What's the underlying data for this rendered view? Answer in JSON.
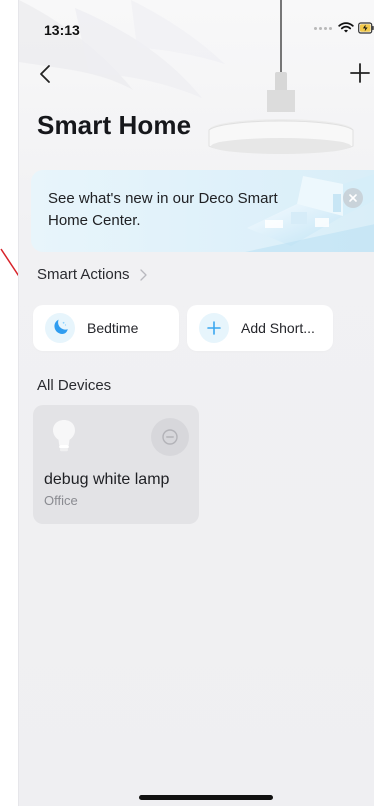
{
  "status_bar": {
    "time": "13:13",
    "icons": [
      "signal-dots-icon",
      "wifi-icon",
      "battery-charging-icon"
    ]
  },
  "navigation": {
    "back_icon": "chevron-left-icon",
    "add_icon": "plus-icon"
  },
  "header": {
    "title": "Smart Home"
  },
  "promo_banner": {
    "text": "See what's new in our Deco Smart Home Center.",
    "close_icon": "close-icon"
  },
  "smart_actions": {
    "title": "Smart Actions",
    "chevron_icon": "chevron-right-icon",
    "items": [
      {
        "label": "Bedtime",
        "icon": "moon-icon",
        "accent": "#2f9df0"
      },
      {
        "label": "Add Short...",
        "icon": "plus-icon",
        "accent": "#3aa7ef"
      }
    ]
  },
  "devices": {
    "title": "All Devices",
    "items": [
      {
        "name": "debug white lamp",
        "room": "Office",
        "icon": "light-bulb-icon",
        "power_icon": "power-off-icon"
      }
    ]
  },
  "colors": {
    "background": "#f1f1f3",
    "card": "#ffffff",
    "device_card": "#e3e3e6",
    "banner": "#e3f3fa",
    "accent_blue": "#2f9df0",
    "annotation_red": "#d8232a"
  },
  "home_indicator": {
    "visible": true
  }
}
